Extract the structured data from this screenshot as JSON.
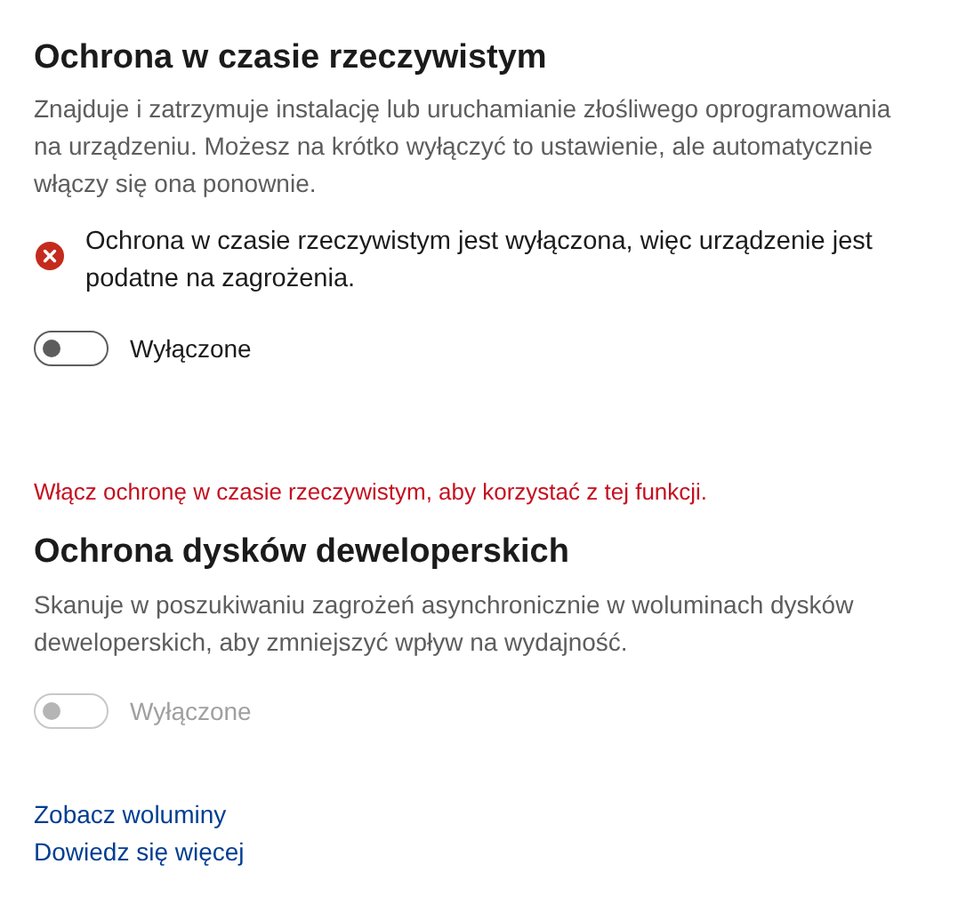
{
  "sections": [
    {
      "title": "Ochrona w czasie rzeczywistym",
      "description": "Znajduje i zatrzymuje instalację lub uruchamianie złośliwego oprogramowania na urządzeniu. Możesz na krótko wyłączyć to ustawienie, ale automatycznie włączy się ona ponownie.",
      "alert": {
        "kind": "error",
        "text": "Ochrona w czasie rzeczywistym jest wyłączona, więc urządzenie jest podatne na zagrożenia."
      },
      "toggle": {
        "label": "Wyłączone",
        "on": false,
        "disabled": false
      }
    },
    {
      "notice": "Włącz ochronę w czasie rzeczywistym, aby korzystać z tej funkcji.",
      "title": "Ochrona dysków deweloperskich",
      "description": "Skanuje w poszukiwaniu zagrożeń asynchronicznie w woluminach dysków deweloperskich, aby zmniejszyć wpływ na wydajność.",
      "toggle": {
        "label": "Wyłączone",
        "on": false,
        "disabled": true
      }
    }
  ],
  "links": [
    "Zobacz woluminy",
    "Dowiedz się więcej"
  ]
}
